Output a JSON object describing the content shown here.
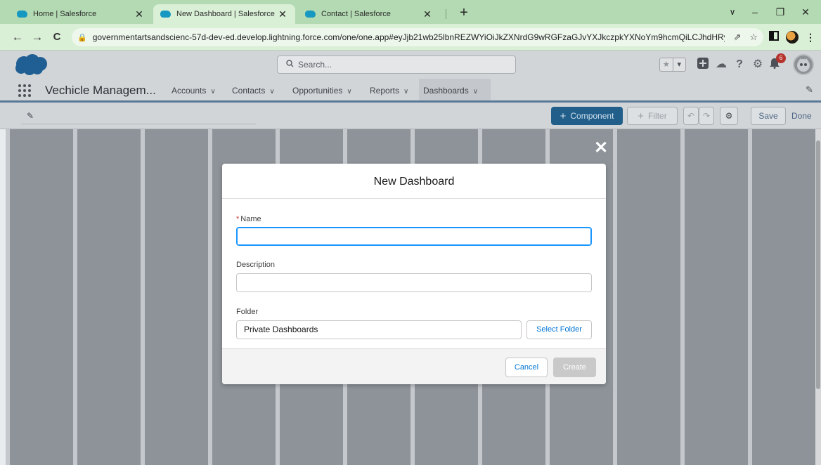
{
  "browser": {
    "tabs": [
      {
        "title": "Home | Salesforce",
        "active": false
      },
      {
        "title": "New Dashboard | Salesforce",
        "active": true
      },
      {
        "title": "Contact | Salesforce",
        "active": false
      }
    ],
    "url": "governmentartsandscienc-57d-dev-ed.develop.lightning.force.com/one/one.app#eyJjb21wb25lbnREZWYiOiJkZXNrdG9wRGFzaGJvYXJkczpkYXNoYm9hcmQiLCJhdHRya...",
    "icons": {
      "back": "←",
      "forward": "→",
      "reload": "C",
      "new_tab": "+",
      "minimize": "–",
      "restore": "❐",
      "close": "✕",
      "chevron": "∨",
      "share": "⇗",
      "star": "☆"
    }
  },
  "sf": {
    "search_placeholder": "Search...",
    "notification_count": "6",
    "app_name": "Vechicle Managem...",
    "nav": [
      {
        "label": "Accounts",
        "active": false
      },
      {
        "label": "Contacts",
        "active": false
      },
      {
        "label": "Opportunities",
        "active": false
      },
      {
        "label": "Reports",
        "active": false
      },
      {
        "label": "Dashboards",
        "active": true
      }
    ],
    "brand_color": "#0176d3"
  },
  "toolbar": {
    "component_label": "Component",
    "filter_label": "Filter",
    "save_label": "Save",
    "done_label": "Done"
  },
  "modal": {
    "title": "New Dashboard",
    "name_label": "Name",
    "name_value": "",
    "description_label": "Description",
    "description_value": "",
    "folder_label": "Folder",
    "folder_value": "Private Dashboards",
    "select_folder_label": "Select Folder",
    "cancel_label": "Cancel",
    "create_label": "Create"
  }
}
